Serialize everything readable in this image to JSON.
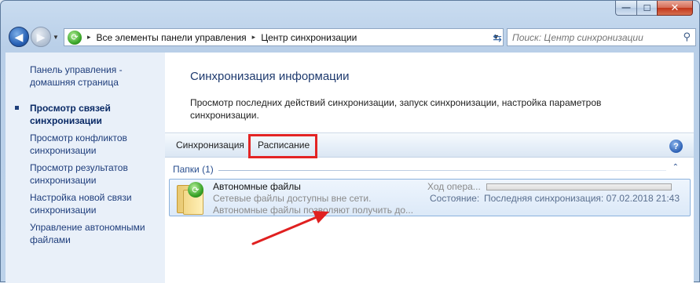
{
  "window": {
    "minimize_glyph": "—",
    "maximize_glyph": "☐",
    "close_glyph": "✕"
  },
  "nav": {
    "back_glyph": "◀",
    "forward_glyph": "▶",
    "history_glyph": "▼"
  },
  "address": {
    "icon": "sync-center-icon",
    "crumbs": [
      "Все элементы панели управления",
      "Центр синхронизации"
    ],
    "separator": "▸"
  },
  "search": {
    "placeholder": "Поиск: Центр синхронизации"
  },
  "sidebar": {
    "items": [
      {
        "label": "Панель управления - домашняя страница"
      },
      {
        "label": "Просмотр связей синхронизации"
      },
      {
        "label": "Просмотр конфликтов синхронизации"
      },
      {
        "label": "Просмотр результатов синхронизации"
      },
      {
        "label": "Настройка новой связи синхронизации"
      },
      {
        "label": "Управление автономными файлами"
      }
    ]
  },
  "main": {
    "title": "Синхронизация информации",
    "description": "Просмотр последних действий синхронизации, запуск синхронизации, настройка параметров синхронизации."
  },
  "toolbar": {
    "sync_label": "Синхронизация",
    "schedule_label": "Расписание",
    "help_glyph": "?"
  },
  "group": {
    "label": "Папки (1)",
    "collapse_glyph": "⌃"
  },
  "item": {
    "name": "Автономные файлы",
    "line1": "Сетевые файлы доступны вне сети.",
    "line2": "Автономные файлы позволяют получить до...",
    "progress_label": "Ход опера...",
    "state_label": "Состояние:",
    "state_value": "Последняя синхронизация: 07.02.2018 21:43"
  },
  "colors": {
    "accent_highlight": "#e32424",
    "arrow": "#e02020"
  }
}
